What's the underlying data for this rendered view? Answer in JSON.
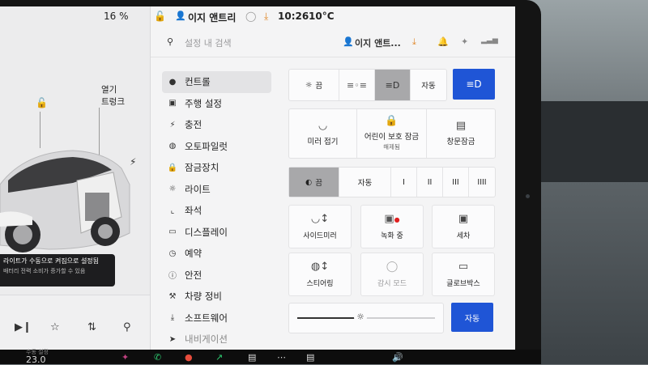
{
  "statusbar": {
    "battery": "16 %",
    "profile": "이지 앤트리",
    "time": "10:26",
    "temperature": "10°C"
  },
  "search": {
    "placeholder": "설정 내 검색",
    "profile_label": "이지 앤트..."
  },
  "menu": {
    "items": [
      {
        "icon": "toggle-icon",
        "label": "컨트롤"
      },
      {
        "icon": "car-icon",
        "label": "주행 설정"
      },
      {
        "icon": "bolt-icon",
        "label": "충전"
      },
      {
        "icon": "steering-wheel-icon",
        "label": "오토파일럿"
      },
      {
        "icon": "lock-icon",
        "label": "잠금장치"
      },
      {
        "icon": "sun-icon",
        "label": "라이트"
      },
      {
        "icon": "seat-icon",
        "label": "좌석"
      },
      {
        "icon": "display-icon",
        "label": "디스플레이"
      },
      {
        "icon": "clock-icon",
        "label": "예약"
      },
      {
        "icon": "info-icon",
        "label": "안전"
      },
      {
        "icon": "wrench-icon",
        "label": "차량 정비"
      },
      {
        "icon": "download-icon",
        "label": "소프트웨어"
      },
      {
        "icon": "navigation-icon",
        "label": "내비게이션"
      }
    ]
  },
  "lights": {
    "off": "끔",
    "auto": "자동"
  },
  "quick": {
    "mirror_fold": "미러 접기",
    "child_lock": "어린이 보호 잠금",
    "child_lock_sub": "해제됨",
    "window_lock": "창문잠금"
  },
  "wipers": {
    "off": "끔",
    "auto": "자동",
    "speeds": [
      "I",
      "II",
      "III",
      "IIII"
    ]
  },
  "grid": {
    "side_mirror": "사이드미러",
    "recording": "녹화 중",
    "car_wash": "세차",
    "steering": "스티어링",
    "sentry": "감시 모드",
    "glovebox": "글로브박스"
  },
  "brightness": {
    "auto": "자동",
    "level": 0.45
  },
  "car_panel": {
    "open_label": "열기",
    "trunk_label": "트렁크",
    "notice_line1": "라이트가 수동으로 켜짐으로 설정됨",
    "notice_line2": "배터리 전력 소비가 증가할 수 있음"
  },
  "taskbar": {
    "temp_label": "수동 설정",
    "temp_value": "23.0"
  }
}
